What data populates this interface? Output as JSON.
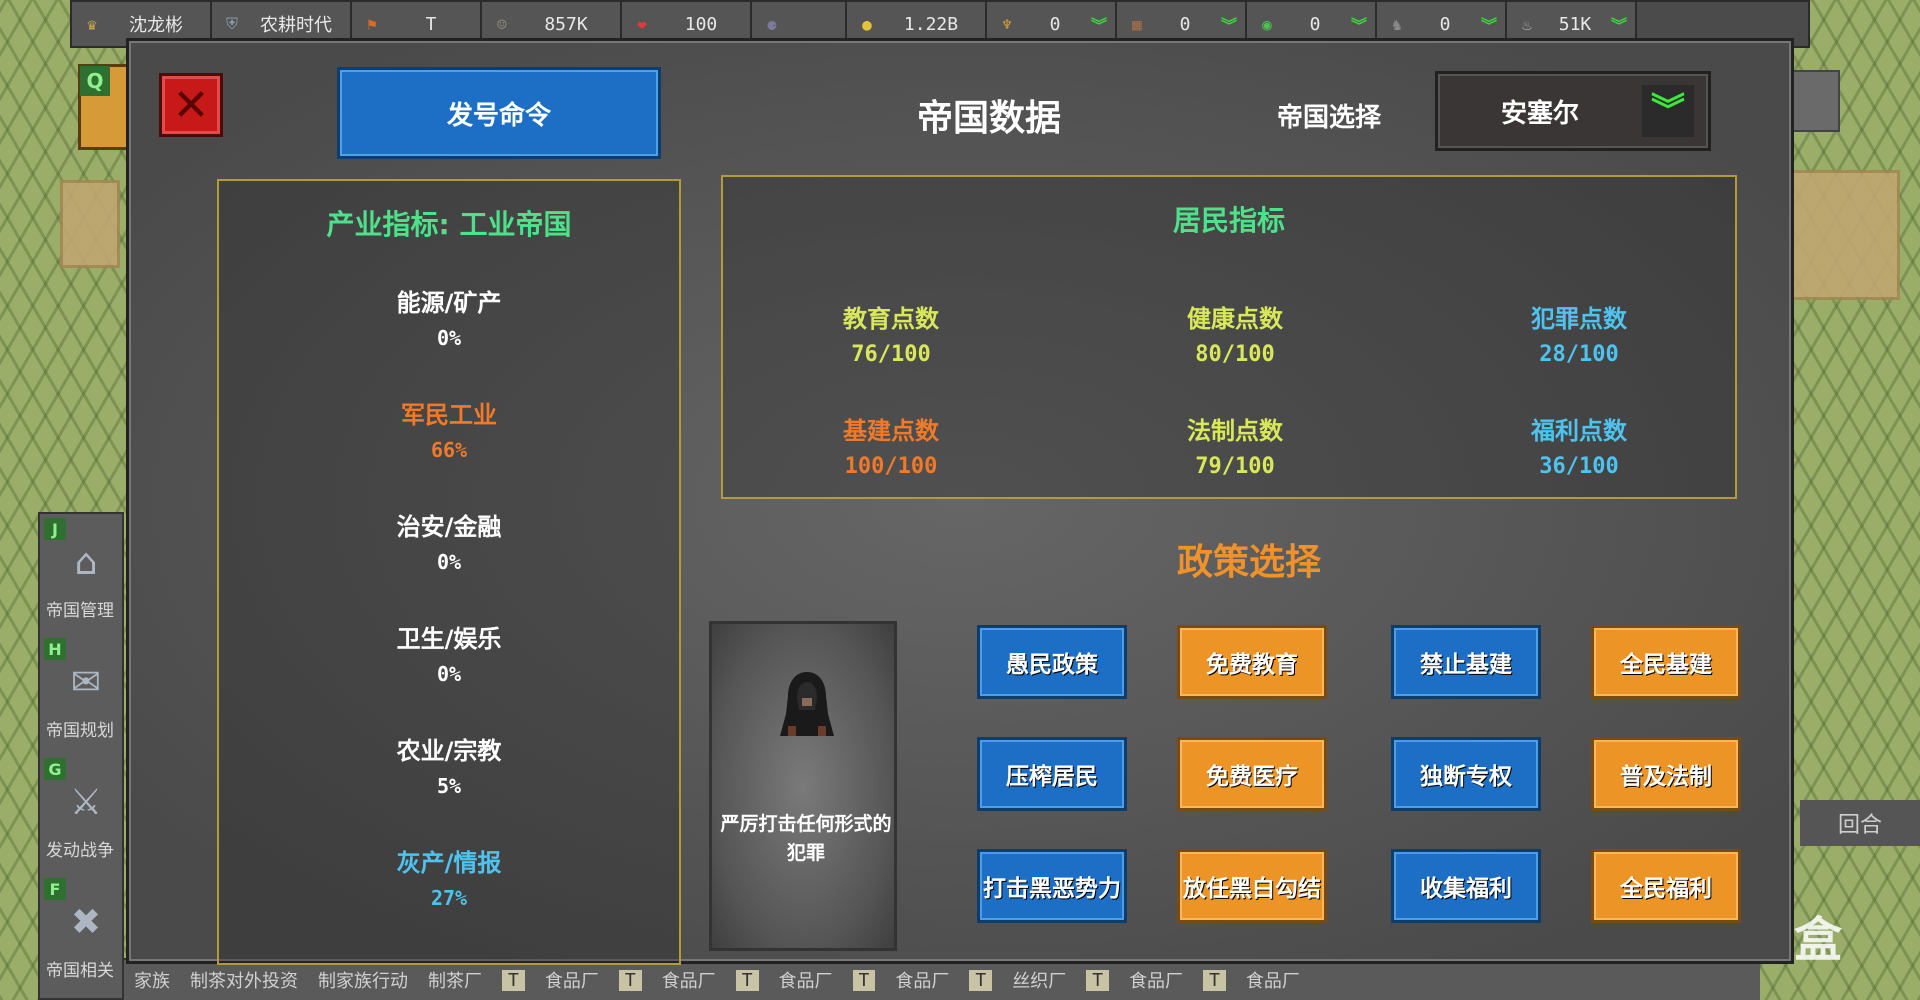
{
  "topbar": {
    "items": [
      {
        "icon": "crown-icon",
        "glyph": "♛",
        "value": "沈龙彬",
        "color": "#c9a64a"
      },
      {
        "icon": "shield-icon",
        "glyph": "⛨",
        "value": "农耕时代",
        "color": "#8a9bb0"
      },
      {
        "icon": "flag-icon",
        "glyph": "⚑",
        "value": "T",
        "color": "#d86a2a"
      },
      {
        "icon": "population-icon",
        "glyph": "☺",
        "value": "857K",
        "color": "#9a8f80"
      },
      {
        "icon": "heart-icon",
        "glyph": "❤",
        "value": "100",
        "color": "#e03a3a"
      },
      {
        "icon": "wheat-ball-icon",
        "glyph": "⚈",
        "value": "",
        "color": "#7a7a9a"
      },
      {
        "icon": "coin-icon",
        "glyph": "●",
        "value": "1.22B",
        "color": "#e6c23a"
      },
      {
        "icon": "wheat-icon",
        "glyph": "♆",
        "value": "0",
        "color": "#d6a23a"
      },
      {
        "icon": "crate-icon",
        "glyph": "▦",
        "value": "0",
        "color": "#a07048"
      },
      {
        "icon": "gem-icon",
        "glyph": "◉",
        "value": "0",
        "color": "#4ec24e"
      },
      {
        "icon": "horse-icon",
        "glyph": "♞",
        "value": "0",
        "color": "#8a8a8a"
      },
      {
        "icon": "teapot-icon",
        "glyph": "♨",
        "value": "51K",
        "color": "#b0b0b0"
      }
    ]
  },
  "side_menu": [
    {
      "key": "J",
      "label": "帝国管理",
      "icon": "house-icon",
      "glyph": "⌂"
    },
    {
      "key": "H",
      "label": "帝国规划",
      "icon": "scroll-icon",
      "glyph": "✉"
    },
    {
      "key": "G",
      "label": "发动战争",
      "icon": "crossed-swords-icon",
      "glyph": "⚔"
    },
    {
      "key": "F",
      "label": "帝国相关",
      "icon": "x-circle-icon",
      "glyph": "✖"
    }
  ],
  "q_key": "Q",
  "bottom_bar": [
    "家族",
    "制茶对外投资",
    "制家族行动",
    "制茶厂",
    "T",
    "食品厂",
    "T",
    "食品厂",
    "T",
    "食品厂",
    "T",
    "食品厂",
    "T",
    "丝织厂",
    "T",
    "食品厂",
    "T",
    "食品厂"
  ],
  "round_label": "回合",
  "watermark": "小黑盒",
  "dialog": {
    "command_button": "发号命令",
    "title": "帝国数据",
    "empire_select_label": "帝国选择",
    "empire_name": "安塞尔",
    "industry": {
      "title": "产业指标: 工业帝国",
      "items": [
        {
          "name": "能源/矿产",
          "value": "0%",
          "color": "#ffffff"
        },
        {
          "name": "军民工业",
          "value": "66%",
          "color": "#f07a2a"
        },
        {
          "name": "治安/金融",
          "value": "0%",
          "color": "#ffffff"
        },
        {
          "name": "卫生/娱乐",
          "value": "0%",
          "color": "#ffffff"
        },
        {
          "name": "农业/宗教",
          "value": "5%",
          "color": "#ffffff"
        },
        {
          "name": "灰产/情报",
          "value": "27%",
          "color": "#4fc3f0"
        }
      ]
    },
    "residents": {
      "title": "居民指标",
      "items": [
        {
          "name": "教育点数",
          "value": "76/100",
          "color": "#d8e85a"
        },
        {
          "name": "健康点数",
          "value": "80/100",
          "color": "#d8e85a"
        },
        {
          "name": "犯罪点数",
          "value": "28/100",
          "color": "#4fc3f0"
        },
        {
          "name": "基建点数",
          "value": "100/100",
          "color": "#f07a2a"
        },
        {
          "name": "法制点数",
          "value": "79/100",
          "color": "#d8e85a"
        },
        {
          "name": "福利点数",
          "value": "36/100",
          "color": "#4fc3f0"
        }
      ]
    },
    "policy": {
      "title": "政策选择",
      "card_text": "严厉打击任何形式的犯罪",
      "buttons": [
        {
          "label": "愚民政策",
          "style": "blue"
        },
        {
          "label": "免费教育",
          "style": "orange"
        },
        {
          "label": "禁止基建",
          "style": "blue"
        },
        {
          "label": "全民基建",
          "style": "orange"
        },
        {
          "label": "压榨居民",
          "style": "blue"
        },
        {
          "label": "免费医疗",
          "style": "orange"
        },
        {
          "label": "独断专权",
          "style": "blue"
        },
        {
          "label": "普及法制",
          "style": "orange"
        },
        {
          "label": "打击黑恶势力",
          "style": "blue"
        },
        {
          "label": "放任黑白勾结",
          "style": "orange"
        },
        {
          "label": "收集福利",
          "style": "blue"
        },
        {
          "label": "全民福利",
          "style": "orange"
        }
      ]
    }
  }
}
